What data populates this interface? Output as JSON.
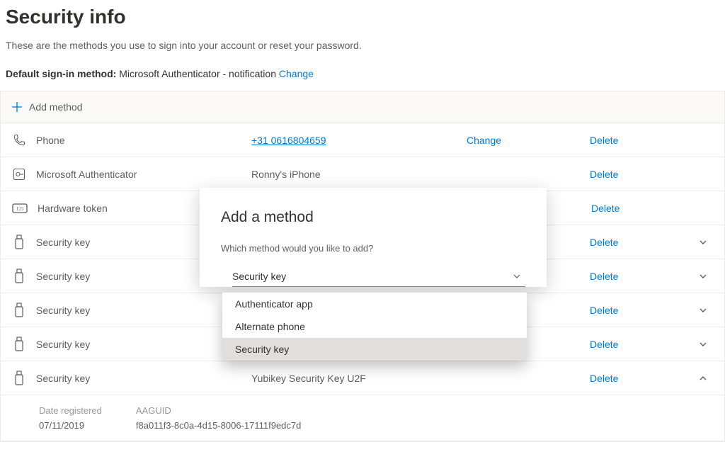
{
  "header": {
    "title": "Security info",
    "subtitle": "These are the methods you use to sign into your account or reset your password.",
    "default_label": "Default sign-in method:",
    "default_value": "Microsoft Authenticator - notification",
    "change_label": "Change"
  },
  "add_method_label": "Add method",
  "actions": {
    "change": "Change",
    "delete": "Delete"
  },
  "methods": [
    {
      "icon": "phone-icon",
      "name": "Phone",
      "value": "+31 0616804659",
      "value_link": true,
      "show_change": true,
      "expandable": false
    },
    {
      "icon": "authenticator-icon",
      "name": "Microsoft Authenticator",
      "value": "Ronny's iPhone",
      "value_link": false,
      "show_change": false,
      "expandable": false
    },
    {
      "icon": "hardware-token-icon",
      "name": "Hardware token",
      "value": "",
      "value_link": false,
      "show_change": false,
      "expandable": false
    },
    {
      "icon": "usb-icon",
      "name": "Security key",
      "value": "",
      "value_link": false,
      "show_change": false,
      "expandable": true,
      "expanded": false
    },
    {
      "icon": "usb-icon",
      "name": "Security key",
      "value": "",
      "value_link": false,
      "show_change": false,
      "expandable": true,
      "expanded": false
    },
    {
      "icon": "usb-icon",
      "name": "Security key",
      "value": "",
      "value_link": false,
      "show_change": false,
      "expandable": true,
      "expanded": false
    },
    {
      "icon": "usb-icon",
      "name": "Security key",
      "value": "",
      "value_link": false,
      "show_change": false,
      "expandable": true,
      "expanded": false
    },
    {
      "icon": "usb-icon",
      "name": "Security key",
      "value": "Yubikey Security Key U2F",
      "value_link": false,
      "show_change": false,
      "expandable": true,
      "expanded": true
    }
  ],
  "expanded_detail": {
    "date_label": "Date registered",
    "date_value": "07/11/2019",
    "aaguid_label": "AAGUID",
    "aaguid_value": "f8a011f3-8c0a-4d15-8006-17111f9edc7d"
  },
  "modal": {
    "title": "Add a method",
    "question": "Which method would you like to add?",
    "selected": "Security key",
    "options": [
      "Authenticator app",
      "Alternate phone",
      "Security key"
    ],
    "selected_index": 2
  }
}
